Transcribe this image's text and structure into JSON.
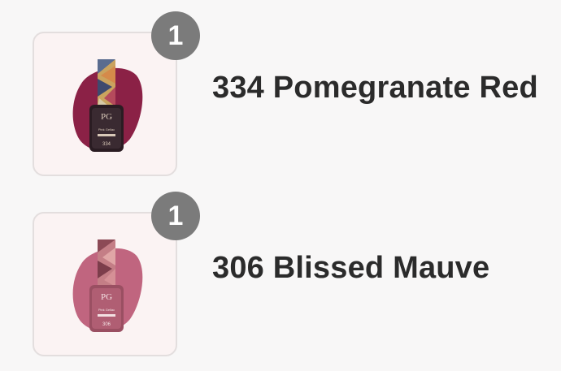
{
  "cart": {
    "items": [
      {
        "name": "334 Pomegranate Red",
        "quantity": "1",
        "image_icon": "nail-polish-bottle-icon",
        "swatch_color": "#8b2146",
        "bottle_label_brand": "PG",
        "bottle_label_line": "Pink Gellac",
        "bottle_label_shade": "Pomegranate Red",
        "bottle_label_code": "334"
      },
      {
        "name": "306 Blissed Mauve",
        "quantity": "1",
        "image_icon": "nail-polish-bottle-icon",
        "swatch_color": "#c0657f",
        "bottle_label_brand": "PG",
        "bottle_label_line": "Pink Gellac",
        "bottle_label_shade": "Blissed Mauve",
        "bottle_label_code": "306"
      }
    ]
  },
  "colors": {
    "background": "#f8f7f7",
    "badge": "#7b7b7b",
    "text": "#2b2b2b",
    "thumb_border": "#e3dede"
  }
}
